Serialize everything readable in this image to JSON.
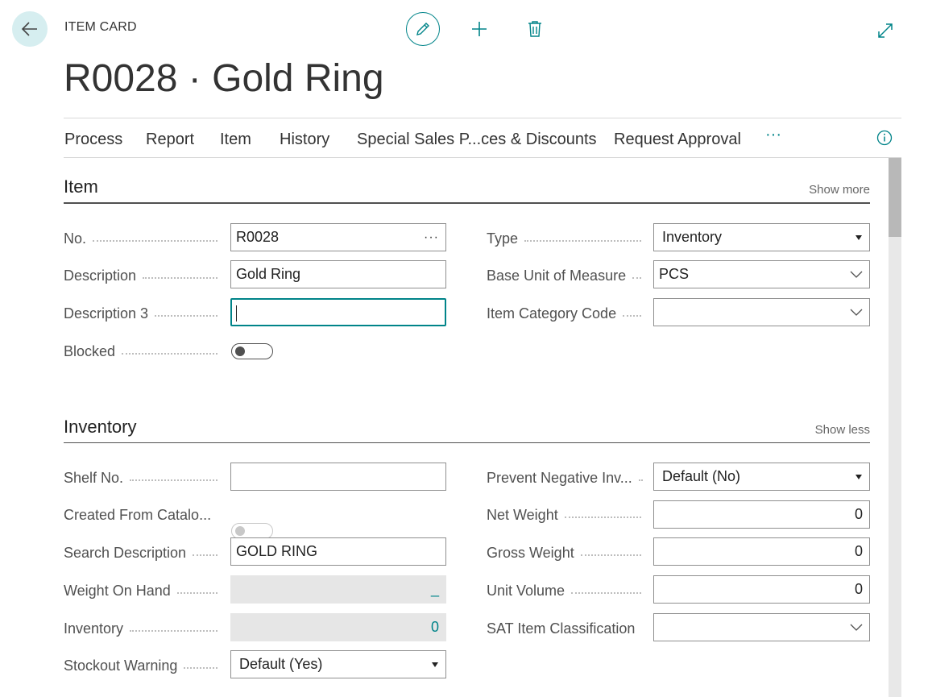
{
  "header": {
    "breadcrumb": "ITEM CARD",
    "title": "R0028 · Gold Ring"
  },
  "nav": {
    "items": [
      "Process",
      "Report",
      "Item",
      "History",
      "Special Sales P...ces & Discounts",
      "Request Approval"
    ],
    "more": "···"
  },
  "sections": {
    "item": {
      "title": "Item",
      "toggle": "Show more"
    },
    "inventory": {
      "title": "Inventory",
      "toggle": "Show less"
    }
  },
  "item": {
    "no_label": "No.",
    "no_value": "R0028",
    "no_more": "···",
    "description_label": "Description",
    "description_value": "Gold Ring",
    "description3_label": "Description 3",
    "description3_value": "",
    "blocked_label": "Blocked",
    "blocked_value": false,
    "type_label": "Type",
    "type_value": "Inventory",
    "base_uom_label": "Base Unit of Measure",
    "base_uom_value": "PCS",
    "item_category_label": "Item Category Code",
    "item_category_value": ""
  },
  "inventory": {
    "shelf_no_label": "Shelf No.",
    "shelf_no_value": "",
    "created_from_catalog_label": "Created From Catalo...",
    "created_from_catalog_value": false,
    "search_description_label": "Search Description",
    "search_description_value": "GOLD RING",
    "weight_on_hand_label": "Weight On Hand",
    "weight_on_hand_value": "_",
    "inventory_label": "Inventory",
    "inventory_value": "0",
    "stockout_warning_label": "Stockout Warning",
    "stockout_warning_value": "Default (Yes)",
    "prevent_negative_label": "Prevent Negative Inv...",
    "prevent_negative_value": "Default (No)",
    "net_weight_label": "Net Weight",
    "net_weight_value": "0",
    "gross_weight_label": "Gross Weight",
    "gross_weight_value": "0",
    "unit_volume_label": "Unit Volume",
    "unit_volume_value": "0",
    "sat_label": "SAT Item Classification",
    "sat_value": ""
  },
  "colors": {
    "accent": "#008489",
    "back_bg": "#d6eef0"
  },
  "icons": [
    "back-arrow-icon",
    "pencil-icon",
    "plus-icon",
    "trash-icon",
    "expand-icon",
    "info-icon",
    "chevron-down-icon",
    "caret-down-icon"
  ]
}
